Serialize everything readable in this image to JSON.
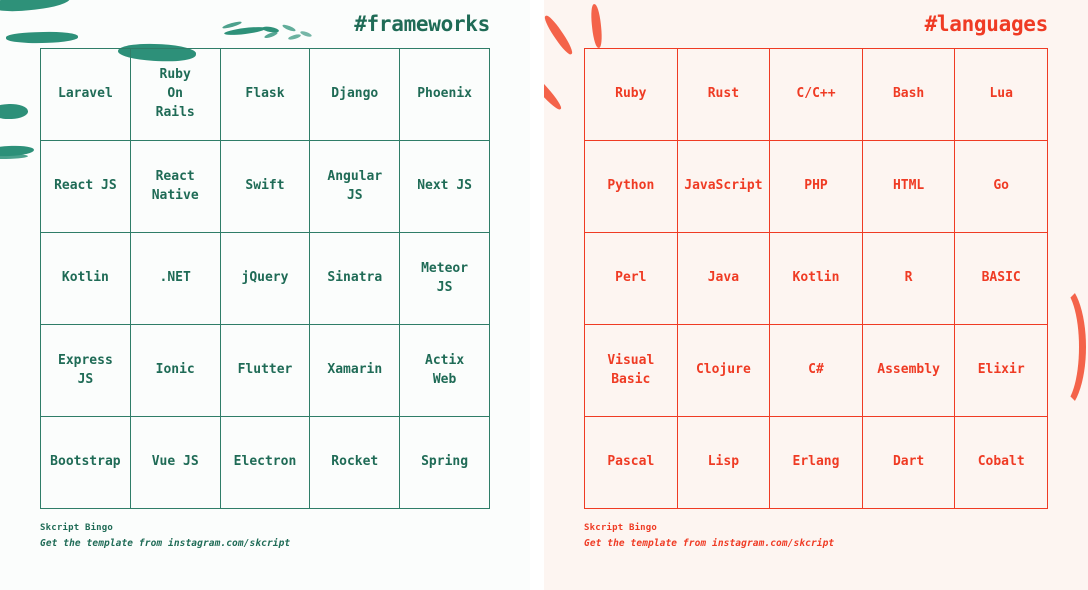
{
  "theme": {
    "green_dark": "#1f6b56",
    "green_border": "#2f7d68",
    "green_brush": "#2e9179",
    "red": "#ef3b24",
    "red_brush": "#f4634a",
    "left_bg": "#fbfdfc",
    "right_bg": "#fdf5f1",
    "page_bg": "#ffffff"
  },
  "cards": [
    {
      "id": "frameworks",
      "title": "#frameworks",
      "footer": {
        "brand": "Skcript Bingo",
        "note": "Get the template from instagram.com/skcript"
      },
      "grid": {
        "rows": 5,
        "cols": 5,
        "cells": [
          [
            "Laravel",
            "Ruby\nOn\nRails",
            "Flask",
            "Django",
            "Phoenix"
          ],
          [
            "React JS",
            "React\nNative",
            "Swift",
            "Angular\nJS",
            "Next JS"
          ],
          [
            "Kotlin",
            ".NET",
            "jQuery",
            "Sinatra",
            "Meteor\nJS"
          ],
          [
            "Express\nJS",
            "Ionic",
            "Flutter",
            "Xamarin",
            "Actix\nWeb"
          ],
          [
            "Bootstrap",
            "Vue JS",
            "Electron",
            "Rocket",
            "Spring"
          ]
        ]
      },
      "decorations": [
        "brush-stroke-horizontal-top",
        "brush-stroke-horizontal-upper-left",
        "brush-stroke-horizontal-center",
        "brush-dot-left-middle",
        "brush-stroke-left-lower",
        "sketch-dashes-top-center"
      ]
    },
    {
      "id": "languages",
      "title": "#languages",
      "footer": {
        "brand": "Skcript Bingo",
        "note": "Get the template from instagram.com/skcript"
      },
      "grid": {
        "rows": 5,
        "cols": 5,
        "cells": [
          [
            "Ruby",
            "Rust",
            "C/C++",
            "Bash",
            "Lua"
          ],
          [
            "Python",
            "JavaScript",
            "PHP",
            "HTML",
            "Go"
          ],
          [
            "Perl",
            "Java",
            "Kotlin",
            "R",
            "BASIC"
          ],
          [
            "Visual\nBasic",
            "Clojure",
            "C#",
            "Assembly",
            "Elixir"
          ],
          [
            "Pascal",
            "Lisp",
            "Erlang",
            "Dart",
            "Cobalt"
          ]
        ]
      },
      "decorations": [
        "spark-stroke-upper-left-a",
        "spark-stroke-upper-left-b",
        "spark-stroke-upper-left-c",
        "arc-stroke-right-inner",
        "arc-stroke-right-outer"
      ]
    }
  ]
}
